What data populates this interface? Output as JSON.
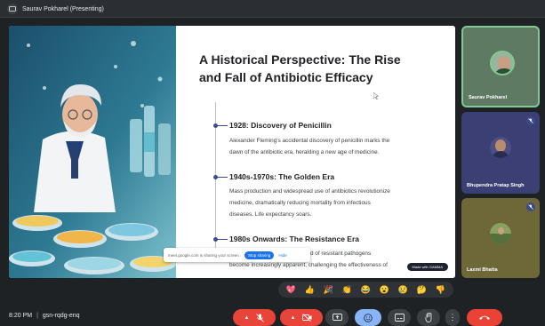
{
  "presenter": {
    "label": "Saurav Pokharel (Presenting)"
  },
  "slide": {
    "title_line1": "A Historical Perspective: The Rise",
    "title_line2": "and Fall of Antibiotic Efficacy",
    "sections": [
      {
        "heading": "1928: Discovery of Penicillin",
        "body1": "Alexander Fleming's accidental discovery of penicillin marks the",
        "body2": "dawn of the antibiotic era, heralding a new age of medicine."
      },
      {
        "heading": "1940s-1970s: The Golden Era",
        "body1": "Mass production and widespread use of antibiotics revolutionize",
        "body2": "medicine, dramatically reducing mortality from infectious",
        "body3": "diseases. Life expectancy soars."
      },
      {
        "heading": "1980s Onwards: The Resistance Era",
        "body1": "The emergence and rapid spread of resistant pathogens",
        "body2": "become increasingly apparent, challenging the effectiveness of"
      }
    ],
    "badge": "Made with GAMMA"
  },
  "share_bar": {
    "text": "meet.google.com is sharing your screen.",
    "stop_label": "Stop sharing",
    "hide_label": "Hide"
  },
  "participants": [
    {
      "name": "Saurav Pokharel",
      "speaking": true
    },
    {
      "name": "Bhupendra Pratap Singh",
      "muted": true
    },
    {
      "name": "Laxmi Bhatta",
      "muted": true
    }
  ],
  "reactions": [
    "💖",
    "👍",
    "🎉",
    "👏",
    "😂",
    "😮",
    "😢",
    "🤔",
    "👎"
  ],
  "meeting": {
    "time": "8:20 PM",
    "separator": "|",
    "code": "gsn-rqdg-enq"
  },
  "colors": {
    "accent": "#8ab4f8",
    "danger": "#ea4335",
    "tile_speaking_border": "#81c995"
  },
  "icons": {
    "mic_off": "mic-off-icon",
    "camera_off": "camera-off-icon",
    "present": "present-screen-icon",
    "emoji": "emoji-icon",
    "captions": "captions-icon",
    "raise_hand": "raise-hand-icon",
    "more": "more-options-icon",
    "end_call": "end-call-icon"
  }
}
